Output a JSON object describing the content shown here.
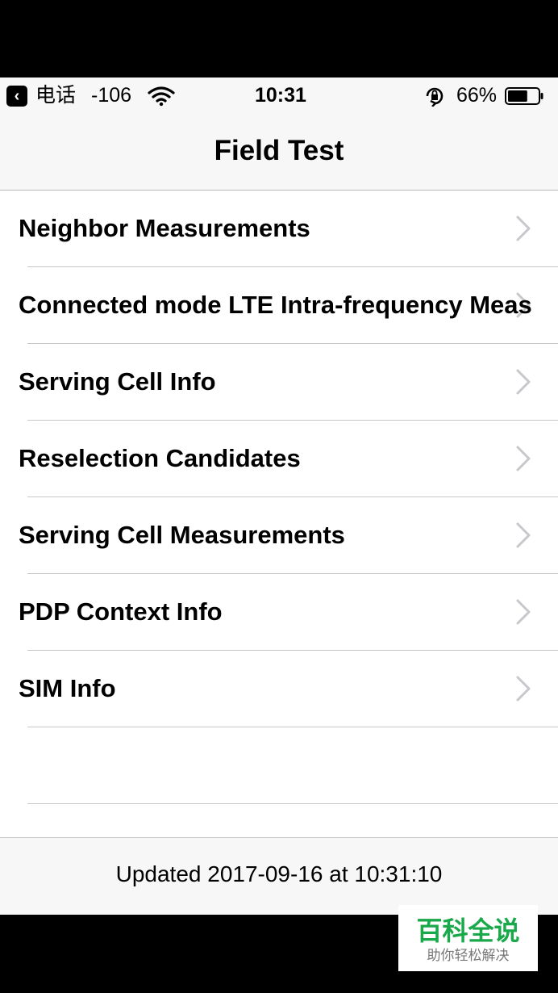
{
  "status_bar": {
    "back_app": "电话",
    "signal": "-106",
    "time": "10:31",
    "battery_percent": "66%",
    "battery_level": 0.66,
    "icons": [
      "back-arrow-icon",
      "wifi-icon",
      "orientation-lock-icon",
      "battery-icon"
    ]
  },
  "nav": {
    "title": "Field Test"
  },
  "menu": {
    "items": [
      {
        "label": "Neighbor Measurements"
      },
      {
        "label": "Connected mode LTE Intra-frequency Meas"
      },
      {
        "label": "Serving Cell Info"
      },
      {
        "label": "Reselection Candidates"
      },
      {
        "label": "Serving Cell Measurements"
      },
      {
        "label": "PDP Context Info"
      },
      {
        "label": "SIM Info"
      },
      {
        "label": ""
      }
    ]
  },
  "footer": {
    "updated_text": "Updated 2017-09-16 at 10:31:10"
  },
  "watermark": {
    "title": "百科全说",
    "subtitle": "助你轻松解决"
  },
  "colors": {
    "accent_green": "#19a84a",
    "separator": "#c8c7cc",
    "chevron": "#c7c7cc",
    "bar_background": "#f7f7f7"
  }
}
